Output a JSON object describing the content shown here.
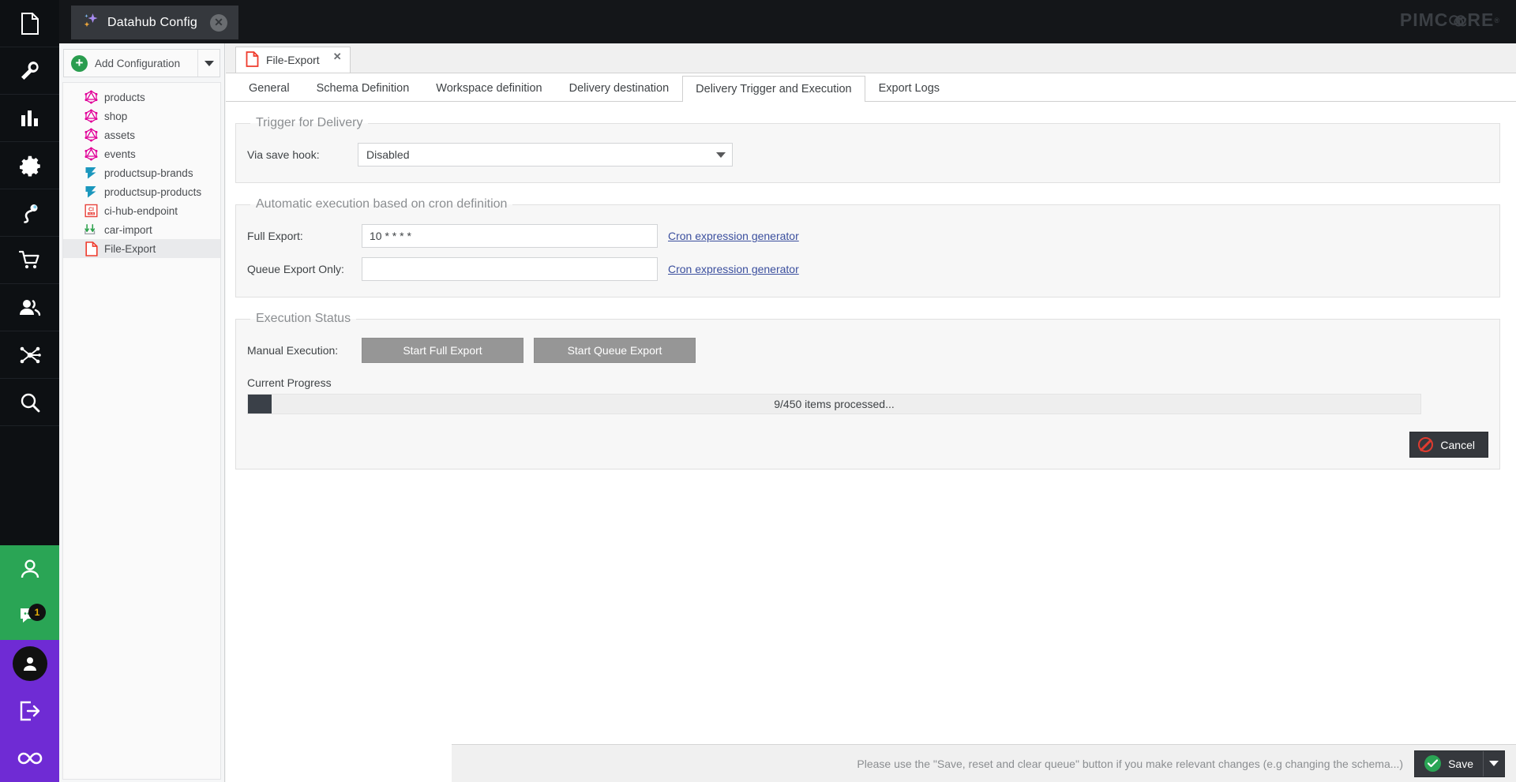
{
  "window": {
    "app_tab_title": "Datahub Config",
    "app_tab_close": "✕",
    "brand": "PIMC",
    "brand_tail": "RE"
  },
  "rail": {
    "items": [
      {
        "name": "documents-icon",
        "label": "Documents"
      },
      {
        "name": "tools-icon",
        "label": "Tools"
      },
      {
        "name": "reports-icon",
        "label": "Reports"
      },
      {
        "name": "settings-gear-icon",
        "label": "Settings"
      },
      {
        "name": "marketing-icon",
        "label": "Marketing"
      },
      {
        "name": "ecommerce-cart-icon",
        "label": "E-Commerce"
      },
      {
        "name": "customers-icon",
        "label": "Customers"
      },
      {
        "name": "datahub-icon",
        "label": "Datahub"
      },
      {
        "name": "search-icon",
        "label": "Search"
      }
    ],
    "bottom_items": [
      {
        "name": "profile-photo-icon",
        "label": "Profile",
        "badge": ""
      },
      {
        "name": "notifications-icon",
        "label": "Notifications",
        "badge": "1"
      },
      {
        "name": "user-account-icon",
        "label": "Account",
        "badge": ""
      },
      {
        "name": "logout-icon",
        "label": "Logout",
        "badge": ""
      },
      {
        "name": "infinity-icon",
        "label": "Perspective",
        "badge": ""
      }
    ]
  },
  "sidebar": {
    "add_configuration_label": "Add Configuration",
    "tree_items": [
      {
        "label": "products",
        "icon": "graphql-icon",
        "selected": false
      },
      {
        "label": "shop",
        "icon": "graphql-icon",
        "selected": false
      },
      {
        "label": "assets",
        "icon": "graphql-icon",
        "selected": false
      },
      {
        "label": "events",
        "icon": "graphql-icon",
        "selected": false
      },
      {
        "label": "productsup-brands",
        "icon": "productsup-icon",
        "selected": false
      },
      {
        "label": "productsup-products",
        "icon": "productsup-icon",
        "selected": false
      },
      {
        "label": "ci-hub-endpoint",
        "icon": "cihub-icon",
        "selected": false
      },
      {
        "label": "car-import",
        "icon": "import-icon",
        "selected": false
      },
      {
        "label": "File-Export",
        "icon": "file-export-icon",
        "selected": true
      }
    ]
  },
  "document_tab": {
    "label": "File-Export",
    "close": "✕"
  },
  "subtabs": [
    {
      "label": "General",
      "active": false
    },
    {
      "label": "Schema Definition",
      "active": false
    },
    {
      "label": "Workspace definition",
      "active": false
    },
    {
      "label": "Delivery destination",
      "active": false
    },
    {
      "label": "Delivery Trigger and Execution",
      "active": true
    },
    {
      "label": "Export Logs",
      "active": false
    }
  ],
  "trigger_for_delivery": {
    "legend": "Trigger for Delivery",
    "via_save_hook_label": "Via save hook:",
    "via_save_hook_value": "Disabled"
  },
  "cron_section": {
    "legend": "Automatic execution based on cron definition",
    "full_export_label": "Full Export:",
    "full_export_value": "10 * * * *",
    "full_export_placeholder": "",
    "queue_export_label": "Queue Export Only:",
    "queue_export_value": "",
    "queue_export_placeholder": "",
    "cron_generator_link": "Cron expression generator"
  },
  "execution_status": {
    "legend": "Execution Status",
    "manual_execution_label": "Manual Execution:",
    "start_full_export_label": "Start Full Export",
    "start_queue_export_label": "Start Queue Export",
    "current_progress_label": "Current Progress",
    "progress_text": "9/450 items processed...",
    "progress_percent": 2,
    "cancel_label": "Cancel"
  },
  "footer": {
    "note": "Please use the \"Save, reset and clear queue\" button if you make relevant changes (e.g changing the schema...)",
    "save_label": "Save"
  },
  "colors": {
    "rail_bg": "#0d1013",
    "green": "#2aa555",
    "purple": "#6f2bd4",
    "graphql_pink": "#e10098",
    "productsup_blue": "#1b97bd",
    "cihub_red": "#e8413a",
    "file_red": "#ef3b2d",
    "link_blue": "#3b4f9e",
    "progress_fill": "#3a4048"
  }
}
